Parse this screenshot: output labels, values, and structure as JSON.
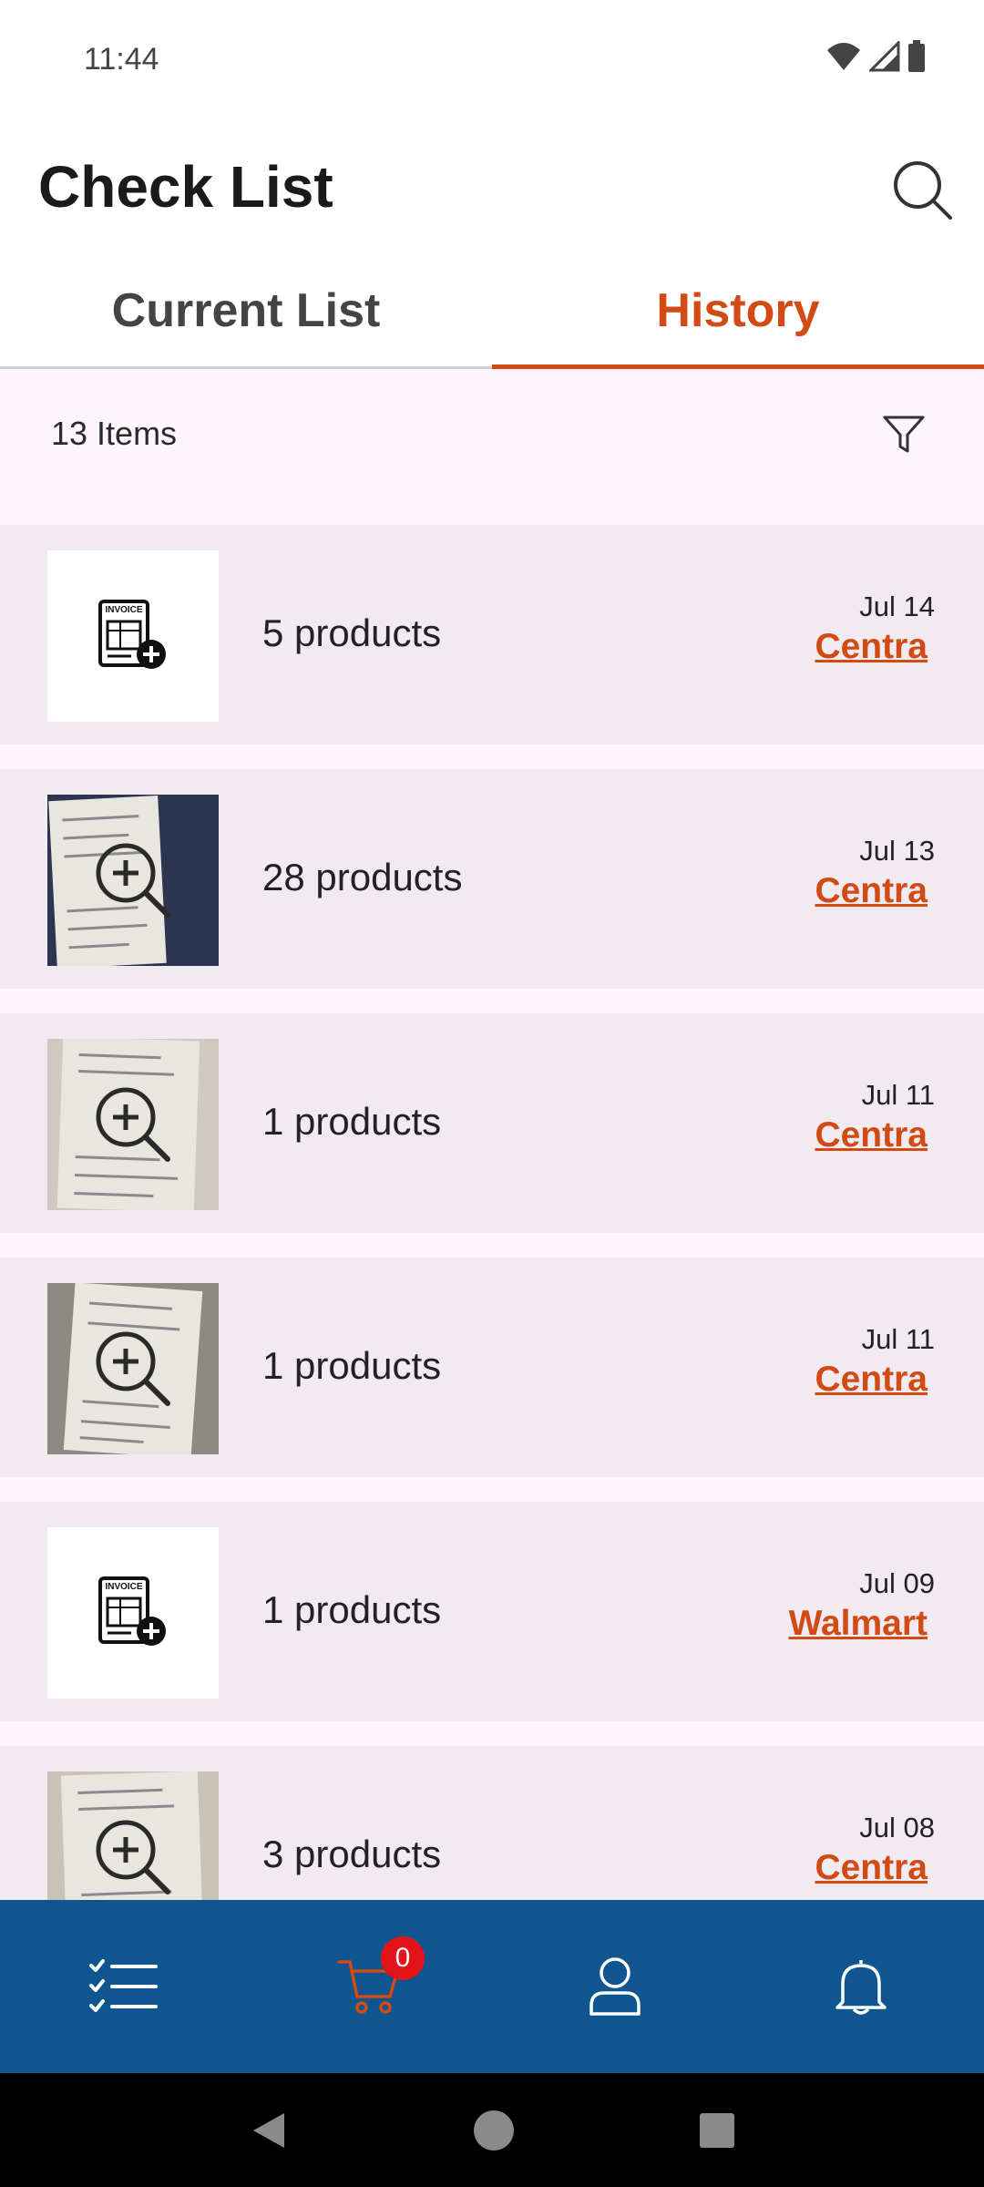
{
  "status_bar": {
    "time": "11:44",
    "icons": [
      "wifi-icon",
      "signal-icon",
      "battery-icon"
    ]
  },
  "header": {
    "title": "Check List",
    "search_icon": "search-icon"
  },
  "tabs": [
    {
      "label": "Current List",
      "active": false
    },
    {
      "label": "History",
      "active": true
    }
  ],
  "list_header": {
    "count_label": "13 Items",
    "filter_icon": "filter-icon"
  },
  "rows": [
    {
      "thumb": "invoice",
      "products": "5 products",
      "date": "Jul 14",
      "store": "Centra"
    },
    {
      "thumb": "receipt",
      "products": "28 products",
      "date": "Jul 13",
      "store": "Centra"
    },
    {
      "thumb": "receipt",
      "products": "1 products",
      "date": "Jul 11",
      "store": "Centra"
    },
    {
      "thumb": "receipt",
      "products": "1 products",
      "date": "Jul 11",
      "store": "Centra"
    },
    {
      "thumb": "invoice",
      "products": "1 products",
      "date": "Jul 09",
      "store": "Walmart"
    },
    {
      "thumb": "receipt",
      "products": "3 products",
      "date": "Jul 08",
      "store": "Centra"
    }
  ],
  "invoice_text": "INVOICE",
  "bottom_nav": {
    "items": [
      "checklist-icon",
      "cart-icon",
      "profile-icon",
      "bell-icon"
    ],
    "cart_count": "0"
  },
  "colors": {
    "accent": "#d24a14",
    "nav_bg": "#0f558f",
    "badge": "#e3131a",
    "row_bg": "#f1eaf1",
    "list_bg": "#fdf6fc"
  }
}
